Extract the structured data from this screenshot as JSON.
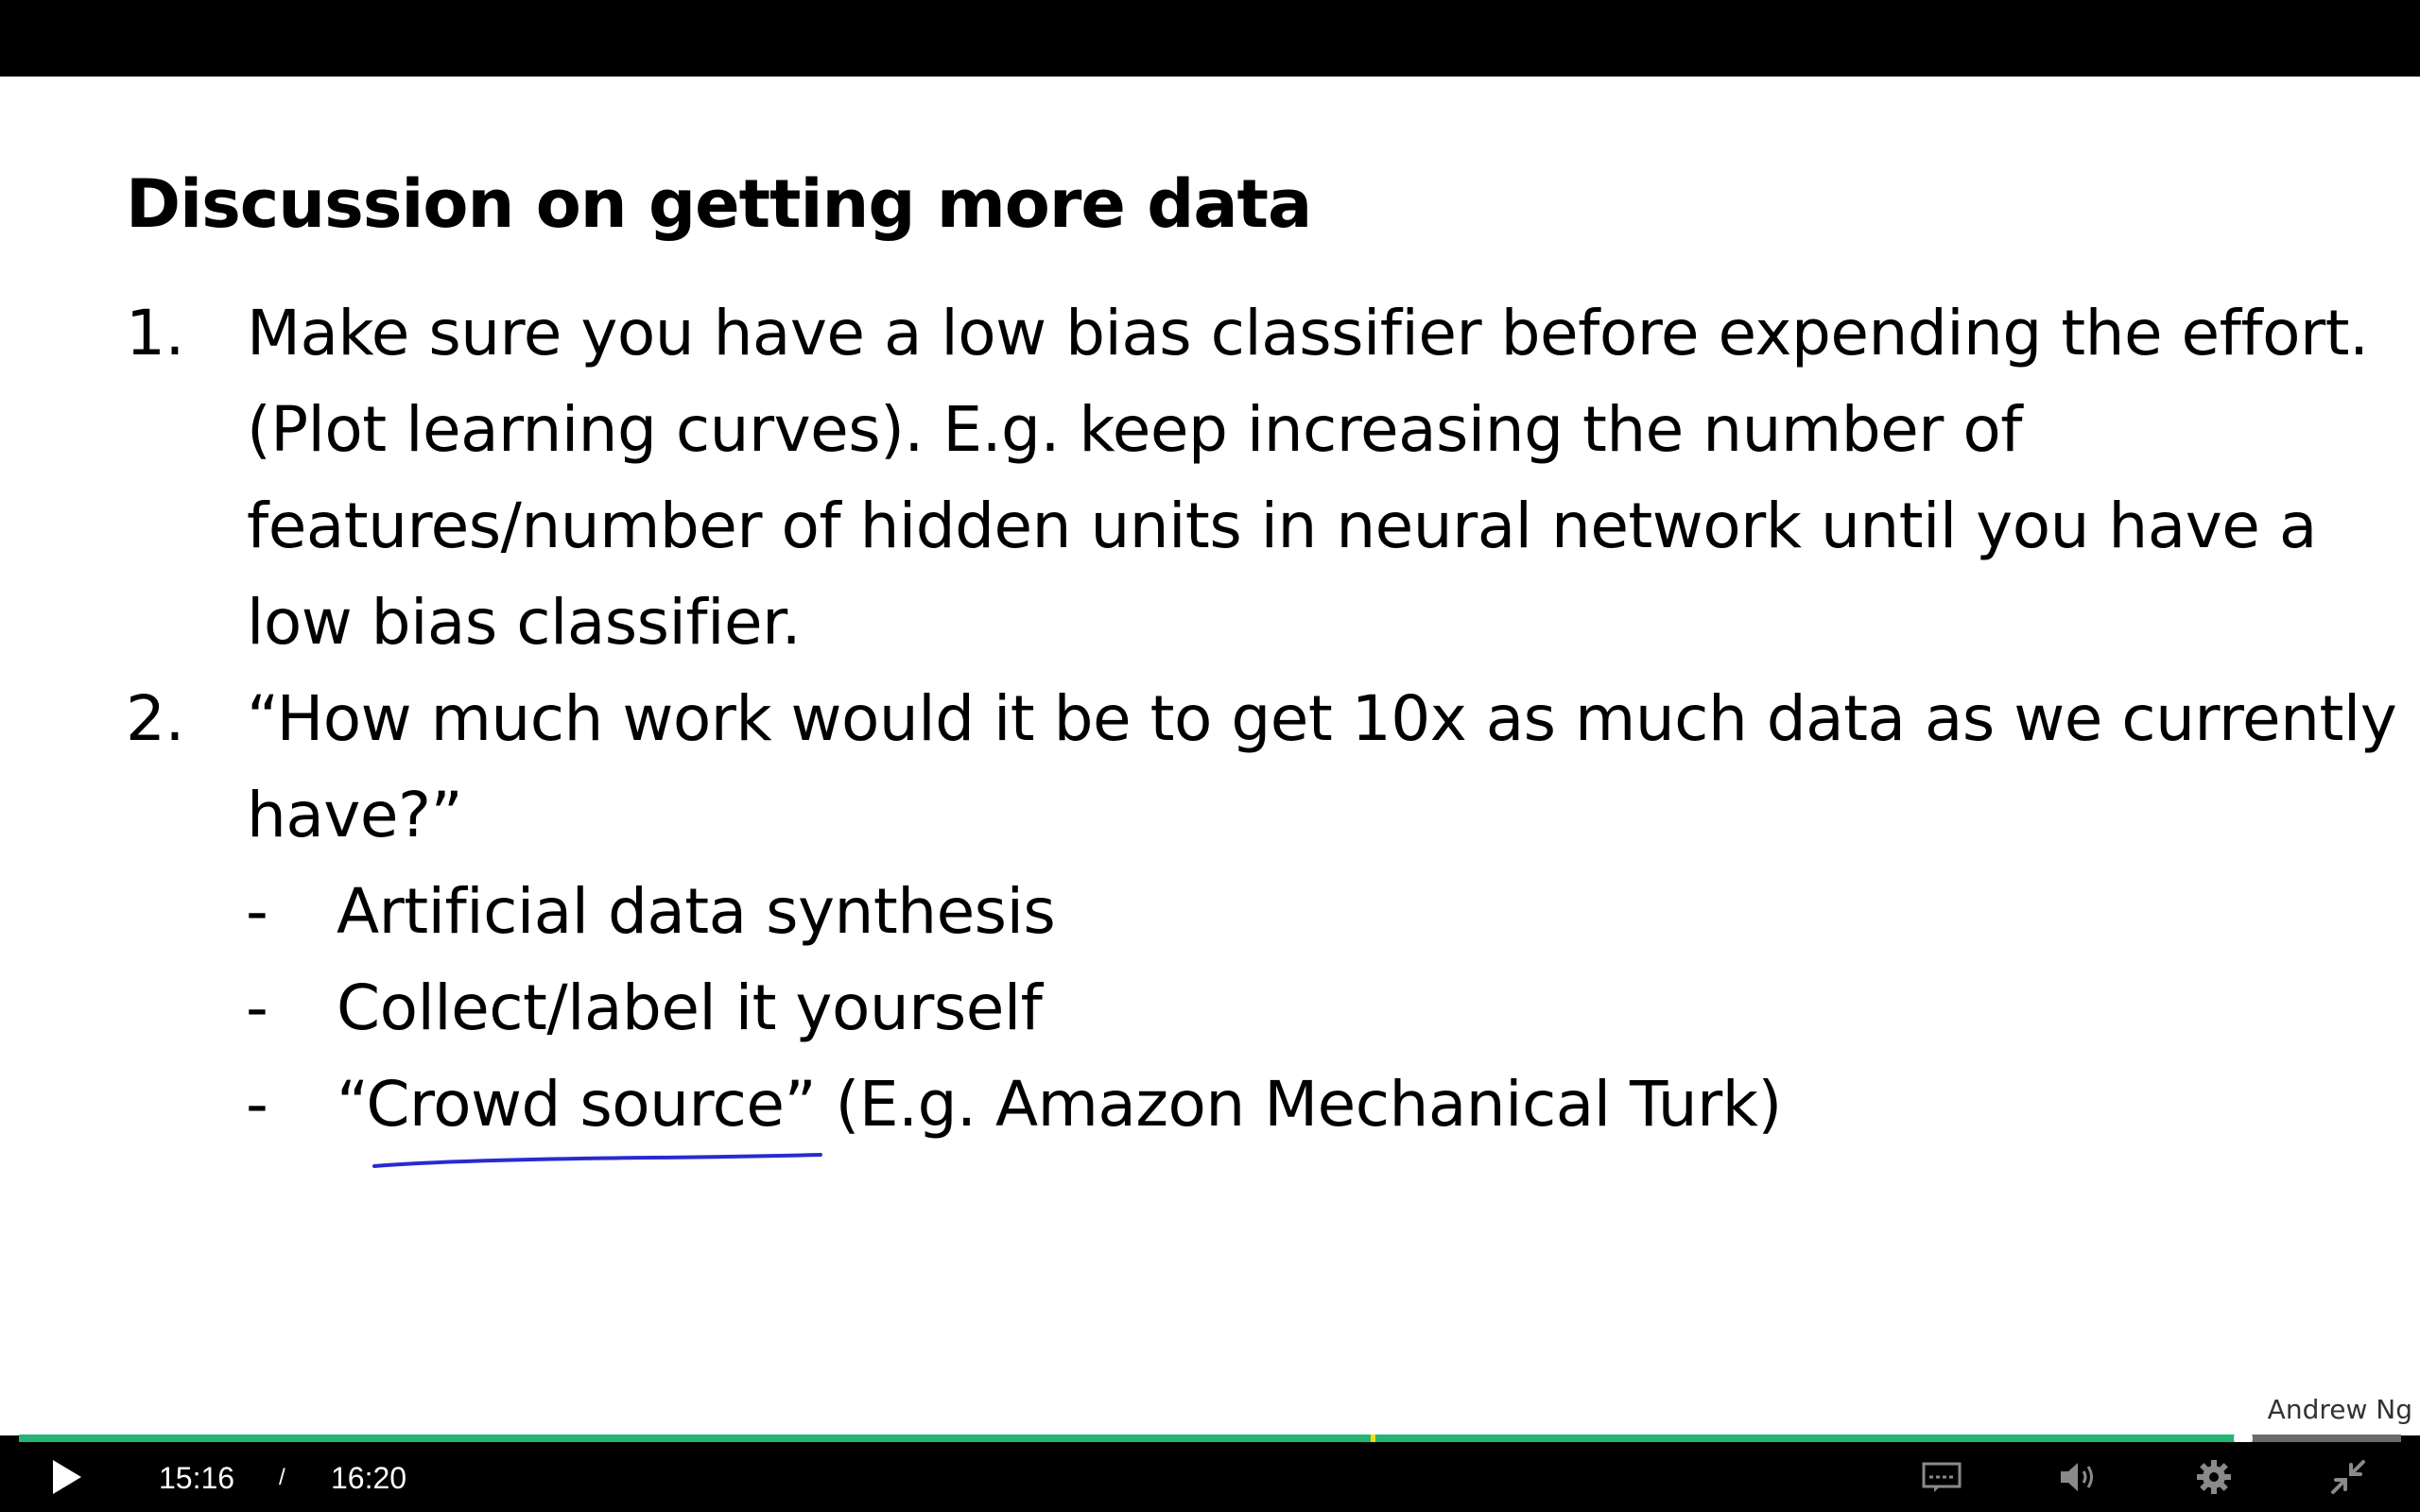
{
  "slide": {
    "title": "Discussion on getting more data",
    "points": [
      {
        "number": "1.",
        "text": "Make sure you have a low bias classifier before expending the effort. (Plot learning curves). E.g. keep increasing the number of features/number of hidden units in neural network until you have a low bias classifier."
      },
      {
        "number": "2.",
        "text": "“How much work would it be to get 10x as much data as we currently have?”"
      }
    ],
    "subpoints": [
      {
        "dash": "-",
        "text": "Artificial data synthesis"
      },
      {
        "dash": "-",
        "text": "Collect/label it yourself"
      },
      {
        "dash": "-",
        "text": "“Crowd source” (E.g. Amazon Mechanical Turk)"
      }
    ],
    "watermark": "Andrew Ng"
  },
  "player": {
    "current_time": "15:16",
    "separator": "/",
    "total_time": "16:20",
    "progress_fraction": 0.9337,
    "chapter_marker_fraction": 0.5675,
    "icons": {
      "play": "play-icon",
      "captions": "captions-icon",
      "volume": "volume-icon",
      "settings": "gear-icon",
      "fullscreen": "exit-fullscreen-icon"
    },
    "colors": {
      "progress": "#22b573",
      "chapter_marker": "#f0e000",
      "annotation_ink": "#2a2ad0"
    }
  }
}
